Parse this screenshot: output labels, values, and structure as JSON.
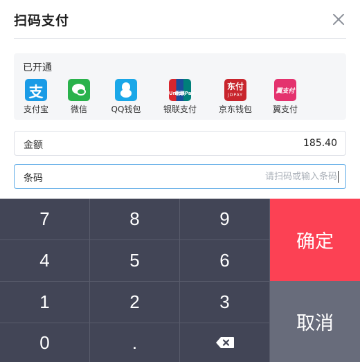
{
  "header": {
    "title": "扫码支付"
  },
  "methods": {
    "title": "已开通",
    "items": [
      {
        "label": "支付宝",
        "icon": "alipay-icon",
        "glyph": "支",
        "color": "#1a9be6"
      },
      {
        "label": "微信",
        "icon": "wechat-icon",
        "color": "#2ab24c"
      },
      {
        "label": "QQ钱包",
        "icon": "qq-wallet-icon",
        "color": "#1aa7e8"
      },
      {
        "label": "银联支付",
        "icon": "unionpay-icon",
        "glyph_line1": "UnionPay",
        "glyph_line2": "银联"
      },
      {
        "label": "京东钱包",
        "icon": "jd-wallet-icon",
        "glyph": "东付",
        "glyph_sub": "JDPAY",
        "color": "#c8252d"
      },
      {
        "label": "翼支付",
        "icon": "bestpay-icon",
        "glyph": "翼支付",
        "color": "#e4326e"
      }
    ]
  },
  "amount": {
    "label": "金额",
    "value": "185.40"
  },
  "barcode": {
    "label": "条码",
    "placeholder": "请扫码或输入条码",
    "value": ""
  },
  "keypad": {
    "keys": [
      "7",
      "8",
      "9",
      "4",
      "5",
      "6",
      "1",
      "2",
      "3",
      "0",
      "."
    ],
    "confirm": "确定",
    "cancel": "取消",
    "backspace_icon": "backspace-icon"
  },
  "colors": {
    "confirm": "#fc4154",
    "cancel": "#686c7b",
    "keypad": "#424556",
    "input_focus": "#5aa9e6"
  }
}
